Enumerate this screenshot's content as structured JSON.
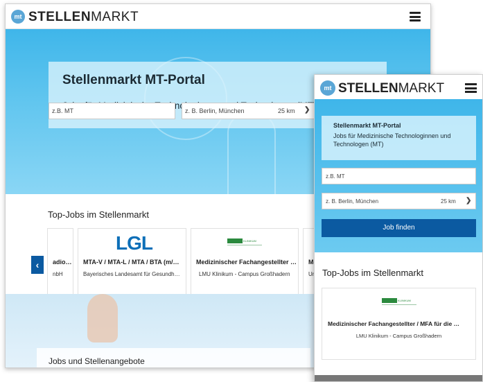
{
  "brand": {
    "badge": "mt",
    "name_bold": "STELLEN",
    "name_light": "MARKT"
  },
  "hero": {
    "title": "Stellenmarkt MT-Portal",
    "subtitle": "Jobs für Medizinische Technologinnen und Technologen (MT)"
  },
  "search": {
    "keyword_placeholder": "z.B. MT",
    "location_placeholder": "z. B. Berlin, München",
    "radius": "25 km",
    "submit_label": "Job finden"
  },
  "topjobs": {
    "title": "Top-Jobs im Stellenmarkt",
    "cards": [
      {
        "title": "adio…",
        "subtitle": "nbH"
      },
      {
        "title": "MTA-V / MTA-L / MTA / BTA (m/…",
        "subtitle": "Bayerisches Landesamt für Gesundh…",
        "logo": "LGL"
      },
      {
        "title": "Medizinischer Fachangestellter …",
        "subtitle": "LMU Klinikum - Campus Großhadern",
        "logo": "KLINIKUM"
      },
      {
        "title": "Me",
        "subtitle": "Univ"
      }
    ],
    "mobile_card": {
      "title": "Medizinischer Fachangestellter / MFA für die …",
      "subtitle": "LMU Klinikum - Campus Großhadern"
    }
  },
  "lower_section": {
    "title": "Jobs und Stellenangebote"
  },
  "icons": {
    "menu": "hamburger-menu-icon",
    "prev": "chevron-left-icon",
    "dropdown": "chevron-down-icon"
  },
  "colors": {
    "primary": "#0b5aa1",
    "hero": "#3fb6ea",
    "logo_badge": "#5aa6d6"
  }
}
